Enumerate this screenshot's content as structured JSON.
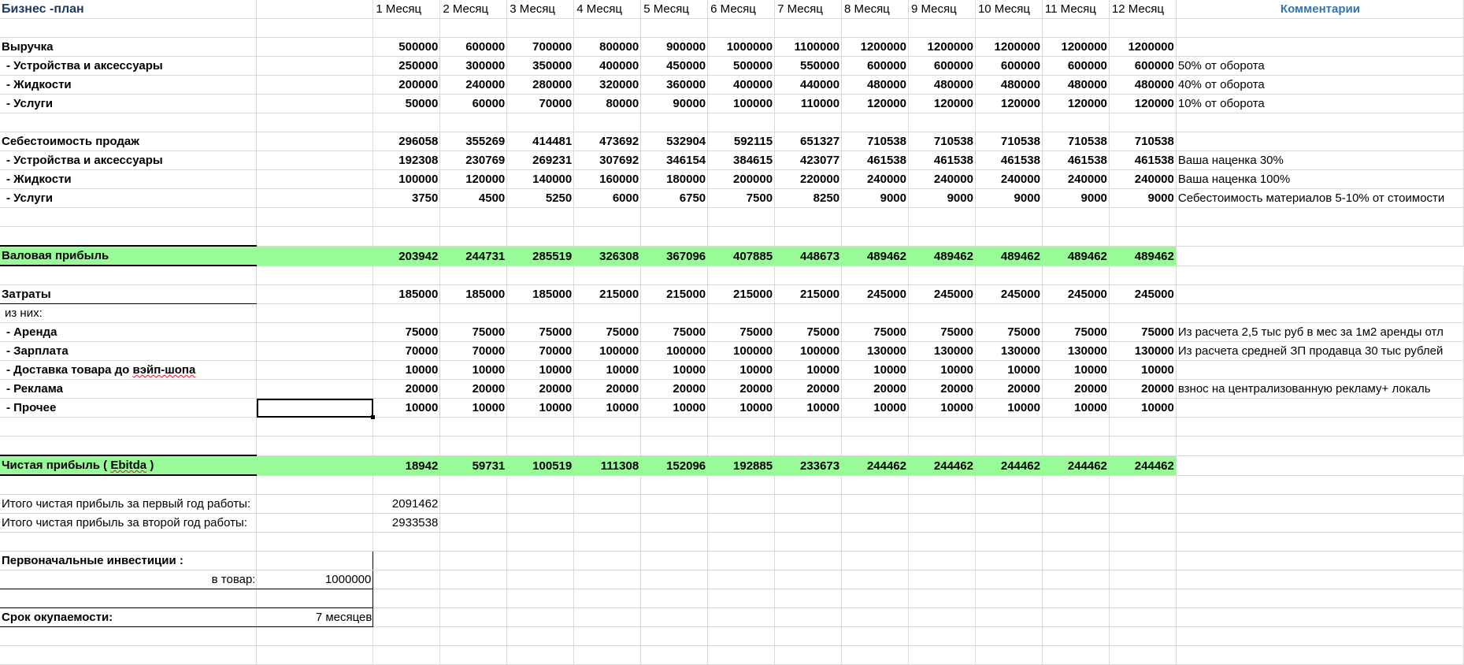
{
  "sheet": {
    "title": "Бизнес -план",
    "comment_header": "Комментарии",
    "months": [
      "1 Месяц",
      "2 Месяц",
      "3 Месяц",
      "4 Месяц",
      "5 Месяц",
      "6 Месяц",
      "7 Месяц",
      "8 Месяц",
      "9 Месяц",
      "10 Месяц",
      "11 Месяц",
      "12 Месяц"
    ],
    "rows": {
      "revenue": {
        "label": "Выручка",
        "values": [
          "500000",
          "600000",
          "700000",
          "800000",
          "900000",
          "1000000",
          "1100000",
          "1200000",
          "1200000",
          "1200000",
          "1200000",
          "1200000"
        ],
        "comment": ""
      },
      "rev_devices": {
        "label": " - Устройства и аксессуары",
        "values": [
          "250000",
          "300000",
          "350000",
          "400000",
          "450000",
          "500000",
          "550000",
          "600000",
          "600000",
          "600000",
          "600000",
          "600000"
        ],
        "comment": "50% от оборота"
      },
      "rev_liquids": {
        "label": " - Жидкости",
        "values": [
          "200000",
          "240000",
          "280000",
          "320000",
          "360000",
          "400000",
          "440000",
          "480000",
          "480000",
          "480000",
          "480000",
          "480000"
        ],
        "comment": "40% от оборота"
      },
      "rev_services": {
        "label": " - Услуги",
        "values": [
          "50000",
          "60000",
          "70000",
          "80000",
          "90000",
          "100000",
          "110000",
          "120000",
          "120000",
          "120000",
          "120000",
          "120000"
        ],
        "comment": "10% от оборота"
      },
      "cogs": {
        "label": "Себестоимость продаж",
        "values": [
          "296058",
          "355269",
          "414481",
          "473692",
          "532904",
          "592115",
          "651327",
          "710538",
          "710538",
          "710538",
          "710538",
          "710538"
        ],
        "comment": ""
      },
      "cogs_devices": {
        "label": " - Устройства и аксессуары",
        "values": [
          "192308",
          "230769",
          "269231",
          "307692",
          "346154",
          "384615",
          "423077",
          "461538",
          "461538",
          "461538",
          "461538",
          "461538"
        ],
        "comment": "Ваша наценка 30%"
      },
      "cogs_liquids": {
        "label": " - Жидкости",
        "values": [
          "100000",
          "120000",
          "140000",
          "160000",
          "180000",
          "200000",
          "220000",
          "240000",
          "240000",
          "240000",
          "240000",
          "240000"
        ],
        "comment": "Ваша наценка 100%"
      },
      "cogs_services": {
        "label": " - Услуги",
        "values": [
          "3750",
          "4500",
          "5250",
          "6000",
          "6750",
          "7500",
          "8250",
          "9000",
          "9000",
          "9000",
          "9000",
          "9000"
        ],
        "comment": "Себестоимость материалов 5-10% от стоимости"
      },
      "gross": {
        "label": "Валовая прибыль",
        "values": [
          "203942",
          "244731",
          "285519",
          "326308",
          "367096",
          "407885",
          "448673",
          "489462",
          "489462",
          "489462",
          "489462",
          "489462"
        ]
      },
      "expenses": {
        "label": "Затраты",
        "values": [
          "185000",
          "185000",
          "185000",
          "215000",
          "215000",
          "215000",
          "215000",
          "245000",
          "245000",
          "245000",
          "245000",
          "245000"
        ]
      },
      "of_them": {
        "label": " из них:"
      },
      "rent": {
        "label": " - Аренда",
        "values": [
          "75000",
          "75000",
          "75000",
          "75000",
          "75000",
          "75000",
          "75000",
          "75000",
          "75000",
          "75000",
          "75000",
          "75000"
        ],
        "comment": "Из расчета 2,5 тыс руб в мес за 1м2 аренды отл"
      },
      "salary": {
        "label": " - Зарплата",
        "values": [
          "70000",
          "70000",
          "70000",
          "100000",
          "100000",
          "100000",
          "100000",
          "130000",
          "130000",
          "130000",
          "130000",
          "130000"
        ],
        "comment": "Из расчета средней ЗП продавца 30 тыс рублей"
      },
      "delivery": {
        "label_pre": " - Доставка товара до ",
        "label_squig": "вэйп-шопа",
        "values": [
          "10000",
          "10000",
          "10000",
          "10000",
          "10000",
          "10000",
          "10000",
          "10000",
          "10000",
          "10000",
          "10000",
          "10000"
        ]
      },
      "ads": {
        "label": " - Реклама",
        "values": [
          "20000",
          "20000",
          "20000",
          "20000",
          "20000",
          "20000",
          "20000",
          "20000",
          "20000",
          "20000",
          "20000",
          "20000"
        ],
        "comment": "взнос на централизованную  рекламу+ локаль"
      },
      "other": {
        "label": " - Прочее",
        "values": [
          "10000",
          "10000",
          "10000",
          "10000",
          "10000",
          "10000",
          "10000",
          "10000",
          "10000",
          "10000",
          "10000",
          "10000"
        ]
      },
      "net": {
        "label_pre": "Чистая прибыль ( ",
        "label_squig": "Ebitda",
        "label_post": " )",
        "values": [
          "18942",
          "59731",
          "100519",
          "111308",
          "152096",
          "192885",
          "233673",
          "244462",
          "244462",
          "244462",
          "244462",
          "244462"
        ]
      }
    },
    "totals": {
      "year1_label": "Итого чистая прибыль за первый год  работы:",
      "year1_value": "2091462",
      "year2_label": "Итого чистая прибыль за второй год работы:",
      "year2_value": "2933538"
    },
    "investment": {
      "label": "Первоначальные инвестиции :",
      "goods_label": "в товар:",
      "goods_value": "1000000"
    },
    "payback": {
      "label": "Срок окупаемости:",
      "value": "7 месяцев"
    }
  }
}
